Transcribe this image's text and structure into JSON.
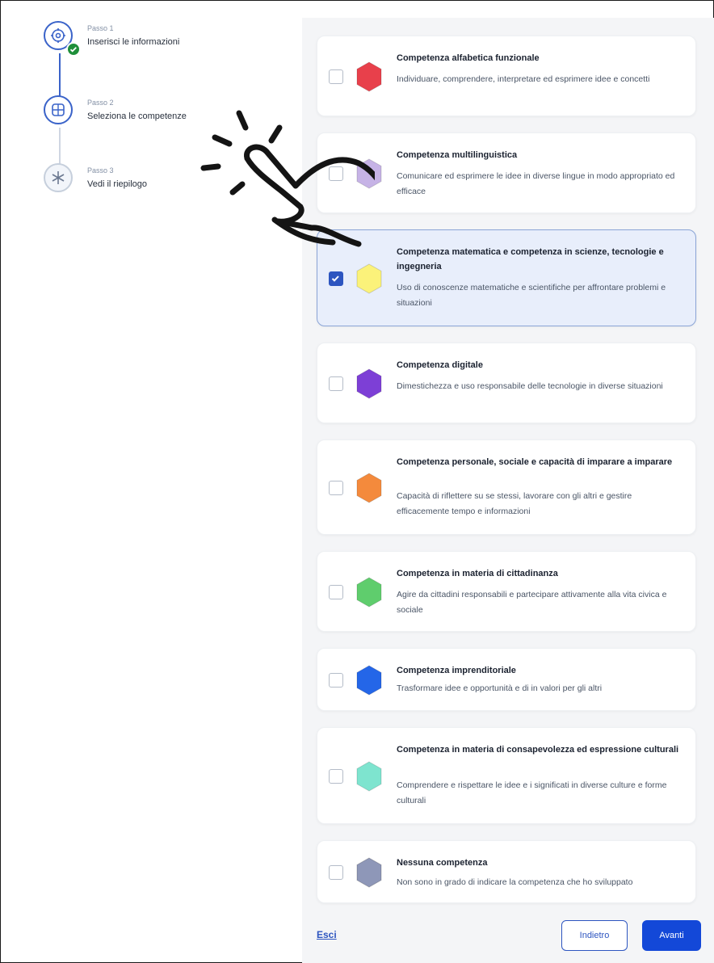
{
  "stepper": {
    "steps": [
      {
        "small": "Passo 1",
        "label": "Inserisci le informazioni",
        "status": "completed",
        "icon": "settings-icon"
      },
      {
        "small": "Passo 2",
        "label": "Seleziona le competenze",
        "status": "current",
        "icon": "grid-icon"
      },
      {
        "small": "Passo 3",
        "label": "Vedi il riepilogo",
        "status": "upcoming",
        "icon": "snowflake-icon"
      }
    ]
  },
  "competences": [
    {
      "title": "Competenza alfabetica funzionale",
      "desc": "Individuare, comprendere, interpretare ed esprimere idee e concetti",
      "color": "#e8404b",
      "checked": false
    },
    {
      "title": "Competenza multilinguistica",
      "desc": "Comunicare ed esprimere le idee in diverse lingue in modo appropriato ed efficace",
      "color": "#c6b3e6",
      "checked": false
    },
    {
      "title": "Competenza matematica e competenza in scienze, tecnologie e ingegneria",
      "desc": "Uso di conoscenze matematiche e scientifiche per affrontare problemi e situazioni",
      "color": "#fbf27a",
      "checked": true
    },
    {
      "title": "Competenza digitale",
      "desc": "Dimestichezza e uso responsabile delle tecnologie in diverse situazioni",
      "color": "#7d3fd6",
      "checked": false
    },
    {
      "title": "Competenza personale, sociale e capacità di imparare a imparare",
      "desc": "Capacità di riflettere su se stessi, lavorare con gli altri e gestire efficacemente tempo e informazioni",
      "color": "#f48a3c",
      "checked": false
    },
    {
      "title": "Competenza in materia di cittadinanza",
      "desc": "Agire da cittadini responsabili e partecipare attivamente alla vita civica e sociale",
      "color": "#5fcd6d",
      "checked": false
    },
    {
      "title": "Competenza imprenditoriale",
      "desc": "Trasformare idee e opportunità e di in valori per gli altri",
      "color": "#2466e8",
      "checked": false
    },
    {
      "title": "Competenza in materia di consapevolezza ed espressione culturali",
      "desc": "Comprendere e rispettare le idee e i significati in diverse culture e forme culturali",
      "color": "#7ee4cf",
      "checked": false
    },
    {
      "title": "Nessuna competenza",
      "desc": "Non sono in grado di indicare la competenza che ho sviluppato",
      "color": "#8e97b8",
      "checked": false
    }
  ],
  "footer": {
    "exit_label": "Esci",
    "back_label": "Indietro",
    "next_label": "Avanti"
  },
  "colors": {
    "accent": "#2d55c0",
    "primary_button": "#1348d8",
    "completed": "#1f8f3a"
  }
}
